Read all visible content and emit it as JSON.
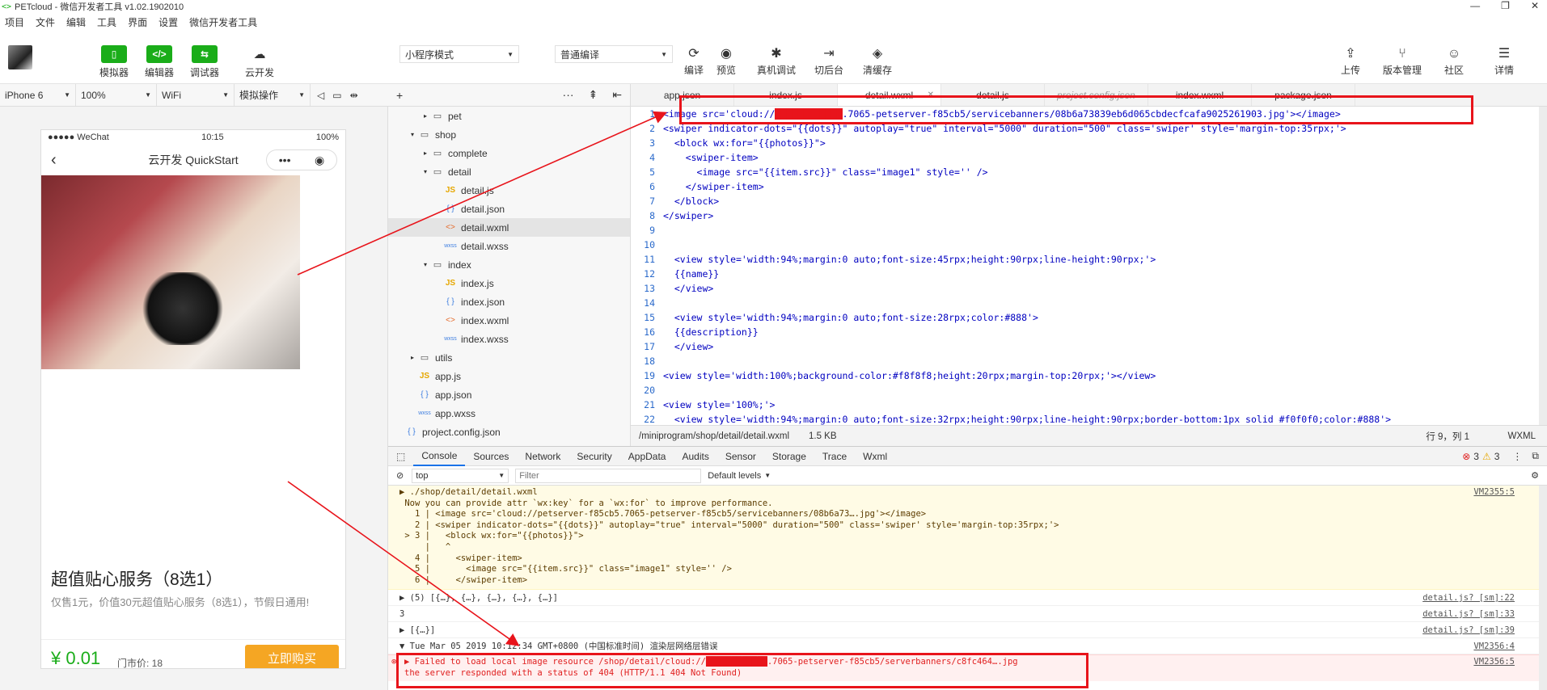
{
  "window": {
    "title": "PETcloud - 微信开发者工具 v1.02.1902010",
    "controls": [
      "—",
      "❐",
      "✕"
    ]
  },
  "menu": [
    "项目",
    "文件",
    "编辑",
    "工具",
    "界面",
    "设置",
    "微信开发者工具"
  ],
  "toolbar": {
    "left_buttons": [
      {
        "label": "模拟器",
        "icon": "phone-icon",
        "glyph": "▯"
      },
      {
        "label": "编辑器",
        "icon": "code-icon",
        "glyph": "</>"
      },
      {
        "label": "调试器",
        "icon": "debug-icon",
        "glyph": "⇆"
      },
      {
        "label": "云开发",
        "icon": "cloud-link-icon",
        "glyph": "☁"
      }
    ],
    "mode_select": "小程序模式",
    "compile_select": "普通编译",
    "center_buttons": [
      {
        "label": "编译",
        "glyph": "⟳"
      },
      {
        "label": "预览",
        "glyph": "◉"
      },
      {
        "label": "真机调试",
        "glyph": "✱"
      },
      {
        "label": "切后台",
        "glyph": "⇥"
      },
      {
        "label": "清缓存",
        "glyph": "◈"
      }
    ],
    "right_buttons": [
      {
        "label": "上传",
        "glyph": "⇪"
      },
      {
        "label": "版本管理",
        "glyph": "⑂"
      },
      {
        "label": "社区",
        "glyph": "☺"
      },
      {
        "label": "详情",
        "glyph": "☰"
      }
    ]
  },
  "simbar": {
    "device": "iPhone 6",
    "zoom": "100%",
    "network": "WiFi",
    "ops": "模拟操作"
  },
  "phone": {
    "carrier": "●●●●● WeChat",
    "time": "10:15",
    "battery": "100%",
    "nav_title": "云开发 QuickStart",
    "product_title": "超值贴心服务（8选1）",
    "product_desc": "仅售1元，价值30元超值贴心服务（8选1），节假日通用!",
    "price": "¥ 0.01",
    "old_price": "门市价: 18",
    "buy_label": "立即购买"
  },
  "explorer": {
    "tree": [
      {
        "label": "pet",
        "type": "folder",
        "depth": 2,
        "arrow": "▸"
      },
      {
        "label": "shop",
        "type": "folder",
        "depth": 1,
        "arrow": "▾"
      },
      {
        "label": "complete",
        "type": "folder",
        "depth": 2,
        "arrow": "▸"
      },
      {
        "label": "detail",
        "type": "folder",
        "depth": 2,
        "arrow": "▾"
      },
      {
        "label": "detail.js",
        "type": "js",
        "depth": 3
      },
      {
        "label": "detail.json",
        "type": "json",
        "depth": 3
      },
      {
        "label": "detail.wxml",
        "type": "wxml",
        "depth": 3,
        "selected": true
      },
      {
        "label": "detail.wxss",
        "type": "wxss",
        "depth": 3
      },
      {
        "label": "index",
        "type": "folder",
        "depth": 2,
        "arrow": "▾"
      },
      {
        "label": "index.js",
        "type": "js",
        "depth": 3
      },
      {
        "label": "index.json",
        "type": "json",
        "depth": 3
      },
      {
        "label": "index.wxml",
        "type": "wxml",
        "depth": 3
      },
      {
        "label": "index.wxss",
        "type": "wxss",
        "depth": 3
      },
      {
        "label": "utils",
        "type": "folder",
        "depth": 1,
        "arrow": "▸"
      },
      {
        "label": "app.js",
        "type": "js",
        "depth": 1
      },
      {
        "label": "app.json",
        "type": "json",
        "depth": 1
      },
      {
        "label": "app.wxss",
        "type": "wxss",
        "depth": 1
      },
      {
        "label": "project.config.json",
        "type": "json",
        "depth": 0
      }
    ]
  },
  "editor": {
    "tabs": [
      {
        "label": "app.json"
      },
      {
        "label": "index.js"
      },
      {
        "label": "detail.wxml",
        "active": true
      },
      {
        "label": "detail.js"
      },
      {
        "label": "project.config.json",
        "dim": true
      },
      {
        "label": "index.wxml"
      },
      {
        "label": "package.json"
      }
    ],
    "lines": [
      {
        "n": "1",
        "t": "<image src='cloud://[REDACTED].7065-petserver-f85cb5/servicebanners/08b6a73839eb6d065cbdecfcafa9025261903.jpg'></image>"
      },
      {
        "n": "2",
        "t": "<swiper indicator-dots=\"{{dots}}\" autoplay=\"true\" interval=\"5000\" duration=\"500\" class='swiper' style='margin-top:35rpx;'>"
      },
      {
        "n": "3",
        "t": "  <block wx:for=\"{{photos}}\">"
      },
      {
        "n": "4",
        "t": "    <swiper-item>"
      },
      {
        "n": "5",
        "t": "      <image src=\"{{item.src}}\" class=\"image1\" style='' />"
      },
      {
        "n": "6",
        "t": "    </swiper-item>"
      },
      {
        "n": "7",
        "t": "  </block>"
      },
      {
        "n": "8",
        "t": "</swiper>"
      },
      {
        "n": "9",
        "t": ""
      },
      {
        "n": "10",
        "t": ""
      },
      {
        "n": "11",
        "t": "  <view style='width:94%;margin:0 auto;font-size:45rpx;height:90rpx;line-height:90rpx;'>"
      },
      {
        "n": "12",
        "t": "  {{name}}"
      },
      {
        "n": "13",
        "t": "  </view>"
      },
      {
        "n": "14",
        "t": ""
      },
      {
        "n": "15",
        "t": "  <view style='width:94%;margin:0 auto;font-size:28rpx;color:#888'>"
      },
      {
        "n": "16",
        "t": "  {{description}}"
      },
      {
        "n": "17",
        "t": "  </view>"
      },
      {
        "n": "18",
        "t": ""
      },
      {
        "n": "19",
        "t": "<view style='width:100%;background-color:#f8f8f8;height:20rpx;margin-top:20rpx;'></view>"
      },
      {
        "n": "20",
        "t": ""
      },
      {
        "n": "21",
        "t": "<view style='100%;'>"
      },
      {
        "n": "22",
        "t": "  <view style='width:94%;margin:0 auto;font-size:32rpx;height:90rpx;line-height:90rpx;border-bottom:1px solid #f0f0f0;color:#888'>"
      }
    ],
    "status_path": "/miniprogram/shop/detail/detail.wxml",
    "status_size": "1.5 KB",
    "status_pos": "行 9，列 1",
    "status_lang": "WXML"
  },
  "devtools": {
    "tabs": [
      "Console",
      "Sources",
      "Network",
      "Security",
      "AppData",
      "Audits",
      "Sensor",
      "Storage",
      "Trace",
      "Wxml"
    ],
    "error_count": "3",
    "warn_count": "3",
    "context": "top",
    "filter_placeholder": "Filter",
    "levels": "Default levels",
    "warning": {
      "lines": [
        "▶ ./shop/detail/detail.wxml",
        " Now you can provide attr `wx:key` for a `wx:for` to improve performance.",
        "   1 | <image src='cloud://petserver-f85cb5.7065-petserver-f85cb5/servicebanners/08b6a73….jpg'></image>",
        "   2 | <swiper indicator-dots=\"{{dots}}\" autoplay=\"true\" interval=\"5000\" duration=\"500\" class='swiper' style='margin-top:35rpx;'>",
        " > 3 |   <block wx:for=\"{{photos}}\">",
        "     |   ^",
        "   4 |     <swiper-item>",
        "   5 |       <image src=\"{{item.src}}\" class=\"image1\" style='' />",
        "   6 |     </swiper-item>"
      ],
      "src": "VM2355:5"
    },
    "rows": [
      {
        "text": "▶ (5) [{…}, {…}, {…}, {…}, {…}]",
        "src": "detail.js? [sm]:22"
      },
      {
        "text": "3",
        "src": "detail.js? [sm]:33"
      },
      {
        "text": "▶ [{…}]",
        "src": "detail.js? [sm]:39"
      },
      {
        "text": "▼ Tue Mar 05 2019 10:12:34 GMT+0800 (中国标准时间) 渲染层网络层错误",
        "src": "VM2356:4"
      }
    ],
    "error": {
      "line1": "Failed to load local image resource /shop/detail/cloud://[REDACTED].7065-petserver-f85cb5/serverbanners/c8fc464….jpg",
      "line2": "the server responded with a status of 404 (HTTP/1.1 404 Not Found)",
      "src": "VM2356:5"
    }
  },
  "colors": {
    "brand_green": "#1aad19",
    "buy_orange": "#f5a623",
    "annotation_red": "#e8141b"
  }
}
